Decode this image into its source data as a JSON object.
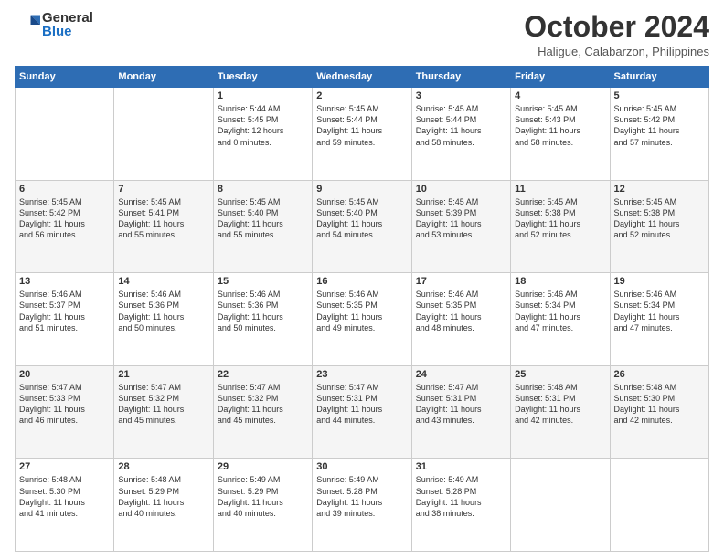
{
  "logo": {
    "general": "General",
    "blue": "Blue"
  },
  "header": {
    "month": "October 2024",
    "location": "Haligue, Calabarzon, Philippines"
  },
  "weekdays": [
    "Sunday",
    "Monday",
    "Tuesday",
    "Wednesday",
    "Thursday",
    "Friday",
    "Saturday"
  ],
  "weeks": [
    [
      {
        "day": "",
        "info": ""
      },
      {
        "day": "",
        "info": ""
      },
      {
        "day": "1",
        "info": "Sunrise: 5:44 AM\nSunset: 5:45 PM\nDaylight: 12 hours\nand 0 minutes."
      },
      {
        "day": "2",
        "info": "Sunrise: 5:45 AM\nSunset: 5:44 PM\nDaylight: 11 hours\nand 59 minutes."
      },
      {
        "day": "3",
        "info": "Sunrise: 5:45 AM\nSunset: 5:44 PM\nDaylight: 11 hours\nand 58 minutes."
      },
      {
        "day": "4",
        "info": "Sunrise: 5:45 AM\nSunset: 5:43 PM\nDaylight: 11 hours\nand 58 minutes."
      },
      {
        "day": "5",
        "info": "Sunrise: 5:45 AM\nSunset: 5:42 PM\nDaylight: 11 hours\nand 57 minutes."
      }
    ],
    [
      {
        "day": "6",
        "info": "Sunrise: 5:45 AM\nSunset: 5:42 PM\nDaylight: 11 hours\nand 56 minutes."
      },
      {
        "day": "7",
        "info": "Sunrise: 5:45 AM\nSunset: 5:41 PM\nDaylight: 11 hours\nand 55 minutes."
      },
      {
        "day": "8",
        "info": "Sunrise: 5:45 AM\nSunset: 5:40 PM\nDaylight: 11 hours\nand 55 minutes."
      },
      {
        "day": "9",
        "info": "Sunrise: 5:45 AM\nSunset: 5:40 PM\nDaylight: 11 hours\nand 54 minutes."
      },
      {
        "day": "10",
        "info": "Sunrise: 5:45 AM\nSunset: 5:39 PM\nDaylight: 11 hours\nand 53 minutes."
      },
      {
        "day": "11",
        "info": "Sunrise: 5:45 AM\nSunset: 5:38 PM\nDaylight: 11 hours\nand 52 minutes."
      },
      {
        "day": "12",
        "info": "Sunrise: 5:45 AM\nSunset: 5:38 PM\nDaylight: 11 hours\nand 52 minutes."
      }
    ],
    [
      {
        "day": "13",
        "info": "Sunrise: 5:46 AM\nSunset: 5:37 PM\nDaylight: 11 hours\nand 51 minutes."
      },
      {
        "day": "14",
        "info": "Sunrise: 5:46 AM\nSunset: 5:36 PM\nDaylight: 11 hours\nand 50 minutes."
      },
      {
        "day": "15",
        "info": "Sunrise: 5:46 AM\nSunset: 5:36 PM\nDaylight: 11 hours\nand 50 minutes."
      },
      {
        "day": "16",
        "info": "Sunrise: 5:46 AM\nSunset: 5:35 PM\nDaylight: 11 hours\nand 49 minutes."
      },
      {
        "day": "17",
        "info": "Sunrise: 5:46 AM\nSunset: 5:35 PM\nDaylight: 11 hours\nand 48 minutes."
      },
      {
        "day": "18",
        "info": "Sunrise: 5:46 AM\nSunset: 5:34 PM\nDaylight: 11 hours\nand 47 minutes."
      },
      {
        "day": "19",
        "info": "Sunrise: 5:46 AM\nSunset: 5:34 PM\nDaylight: 11 hours\nand 47 minutes."
      }
    ],
    [
      {
        "day": "20",
        "info": "Sunrise: 5:47 AM\nSunset: 5:33 PM\nDaylight: 11 hours\nand 46 minutes."
      },
      {
        "day": "21",
        "info": "Sunrise: 5:47 AM\nSunset: 5:32 PM\nDaylight: 11 hours\nand 45 minutes."
      },
      {
        "day": "22",
        "info": "Sunrise: 5:47 AM\nSunset: 5:32 PM\nDaylight: 11 hours\nand 45 minutes."
      },
      {
        "day": "23",
        "info": "Sunrise: 5:47 AM\nSunset: 5:31 PM\nDaylight: 11 hours\nand 44 minutes."
      },
      {
        "day": "24",
        "info": "Sunrise: 5:47 AM\nSunset: 5:31 PM\nDaylight: 11 hours\nand 43 minutes."
      },
      {
        "day": "25",
        "info": "Sunrise: 5:48 AM\nSunset: 5:31 PM\nDaylight: 11 hours\nand 42 minutes."
      },
      {
        "day": "26",
        "info": "Sunrise: 5:48 AM\nSunset: 5:30 PM\nDaylight: 11 hours\nand 42 minutes."
      }
    ],
    [
      {
        "day": "27",
        "info": "Sunrise: 5:48 AM\nSunset: 5:30 PM\nDaylight: 11 hours\nand 41 minutes."
      },
      {
        "day": "28",
        "info": "Sunrise: 5:48 AM\nSunset: 5:29 PM\nDaylight: 11 hours\nand 40 minutes."
      },
      {
        "day": "29",
        "info": "Sunrise: 5:49 AM\nSunset: 5:29 PM\nDaylight: 11 hours\nand 40 minutes."
      },
      {
        "day": "30",
        "info": "Sunrise: 5:49 AM\nSunset: 5:28 PM\nDaylight: 11 hours\nand 39 minutes."
      },
      {
        "day": "31",
        "info": "Sunrise: 5:49 AM\nSunset: 5:28 PM\nDaylight: 11 hours\nand 38 minutes."
      },
      {
        "day": "",
        "info": ""
      },
      {
        "day": "",
        "info": ""
      }
    ]
  ]
}
